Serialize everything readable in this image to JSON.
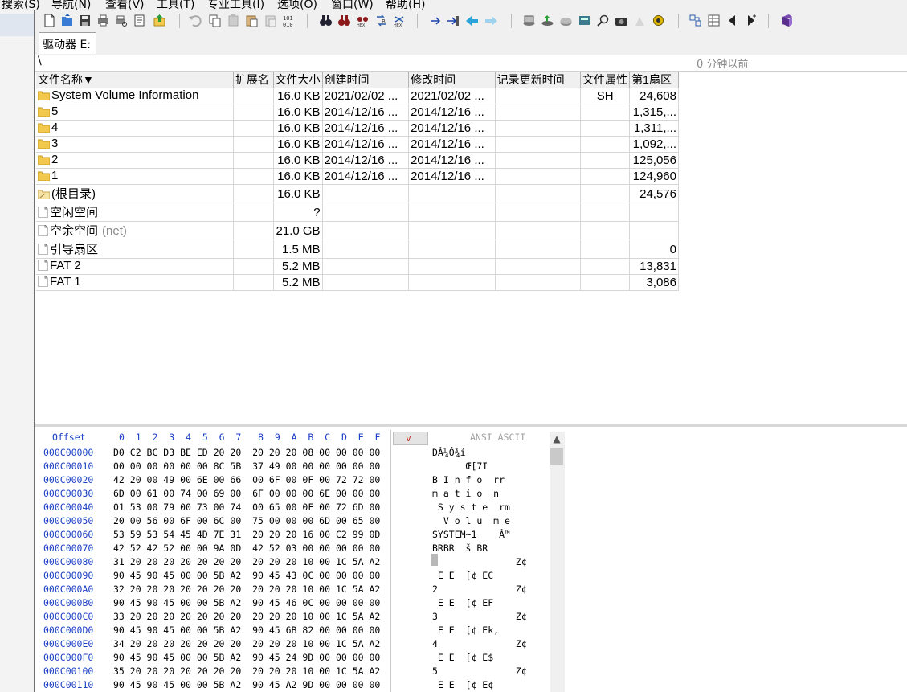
{
  "menu": [
    "搜索(S)",
    "导航(N)",
    "查看(V)",
    "工具(T)",
    "专业工具(I)",
    "选项(O)",
    "窗口(W)",
    "帮助(H)"
  ],
  "toolbar_icons": [
    "new-file-icon",
    "open-icon",
    "save-icon",
    "print-icon",
    "print-preview-icon",
    "properties-icon",
    "export-icon",
    "undo-icon",
    "copy-icon",
    "paste-icon",
    "paste-into-icon",
    "clipboard-icon",
    "convert-binary-icon",
    "find-icon",
    "find-text-icon",
    "find-hex-icon",
    "replace-text-icon",
    "replace-hex-icon",
    "goto-offset-icon",
    "goto-sector-icon",
    "back-arrow-icon",
    "forward-arrow-icon",
    "open-disk-icon",
    "disk-tools-icon",
    "disk-clone-icon",
    "calculator-icon",
    "search-icon",
    "camera-icon",
    "text-file-icon",
    "settings-gear-icon",
    "data-interpreter-icon",
    "template-icon",
    "prev-sector-icon",
    "next-sector-icon",
    "help-book-icon"
  ],
  "tab": {
    "label": "驱动器 E:"
  },
  "path": {
    "text": "\\",
    "time": "0 分钟以前"
  },
  "columns": [
    "文件名称▼",
    "扩展名",
    "文件大小",
    "创建时间",
    "修改时间",
    "记录更新时间",
    "文件属性",
    "第1扇区"
  ],
  "rows": [
    {
      "icon": "folder",
      "name": "System Volume Information",
      "ext": "",
      "size": "16.0 KB",
      "created": "2021/02/02  ...",
      "modified": "2021/02/02  ...",
      "updated": "",
      "attr": "SH",
      "sector": "24,608"
    },
    {
      "icon": "folder",
      "name": "5",
      "ext": "",
      "size": "16.0 KB",
      "created": "2014/12/16  ...",
      "modified": "2014/12/16  ...",
      "updated": "",
      "attr": "",
      "sector": "1,315,..."
    },
    {
      "icon": "folder",
      "name": "4",
      "ext": "",
      "size": "16.0 KB",
      "created": "2014/12/16  ...",
      "modified": "2014/12/16  ...",
      "updated": "",
      "attr": "",
      "sector": "1,311,..."
    },
    {
      "icon": "folder",
      "name": "3",
      "ext": "",
      "size": "16.0 KB",
      "created": "2014/12/16  ...",
      "modified": "2014/12/16  ...",
      "updated": "",
      "attr": "",
      "sector": "1,092,..."
    },
    {
      "icon": "folder",
      "name": "2",
      "ext": "",
      "size": "16.0 KB",
      "created": "2014/12/16  ...",
      "modified": "2014/12/16  ...",
      "updated": "",
      "attr": "",
      "sector": "125,056"
    },
    {
      "icon": "folder",
      "name": "1",
      "ext": "",
      "size": "16.0 KB",
      "created": "2014/12/16  ...",
      "modified": "2014/12/16  ...",
      "updated": "",
      "attr": "",
      "sector": "124,960"
    },
    {
      "icon": "root-folder",
      "name": "(根目录)",
      "ext": "",
      "size": "16.0 KB",
      "created": "",
      "modified": "",
      "updated": "",
      "attr": "",
      "sector": "24,576"
    },
    {
      "icon": "file",
      "name": "空闲空间",
      "ext": "",
      "size": "?",
      "created": "",
      "modified": "",
      "updated": "",
      "attr": "",
      "sector": ""
    },
    {
      "icon": "file",
      "name": "空余空间",
      "suffix": "(net)",
      "ext": "",
      "size": "21.0 GB",
      "created": "",
      "modified": "",
      "updated": "",
      "attr": "",
      "sector": ""
    },
    {
      "icon": "file",
      "name": "引导扇区",
      "ext": "",
      "size": "1.5 MB",
      "created": "",
      "modified": "",
      "updated": "",
      "attr": "",
      "sector": "0"
    },
    {
      "icon": "file",
      "name": "FAT 2",
      "ext": "",
      "size": "5.2 MB",
      "created": "",
      "modified": "",
      "updated": "",
      "attr": "",
      "sector": "13,831"
    },
    {
      "icon": "file",
      "name": "FAT 1",
      "ext": "",
      "size": "5.2 MB",
      "created": "",
      "modified": "",
      "updated": "",
      "attr": "",
      "sector": "3,086"
    }
  ],
  "hex": {
    "offset_label": "Offset",
    "col_headers": "0  1  2  3  4  5  6  7   8  9  A  B  C  D  E  F",
    "v_label": "v",
    "ascii_label": "ANSI ASCII",
    "lines": [
      {
        "offset": "000C00000",
        "bytes": "D0 C2 BC D3 BE ED 20 20  20 20 20 08 00 00 00 00",
        "ascii": "ĐÂ¼Ó¾í"
      },
      {
        "offset": "000C00010",
        "bytes": "00 00 00 00 00 00 8C 5B  37 49 00 00 00 00 00 00",
        "ascii": "      Œ[7I"
      },
      {
        "offset": "000C00020",
        "bytes": "42 20 00 49 00 6E 00 66  00 6F 00 0F 00 72 72 00",
        "ascii": "B I n f o  rr"
      },
      {
        "offset": "000C00030",
        "bytes": "6D 00 61 00 74 00 69 00  6F 00 00 00 6E 00 00 00",
        "ascii": "m a t i o  n"
      },
      {
        "offset": "000C00040",
        "bytes": "01 53 00 79 00 73 00 74  00 65 00 0F 00 72 6D 00",
        "ascii": " S y s t e  rm"
      },
      {
        "offset": "000C00050",
        "bytes": "20 00 56 00 6F 00 6C 00  75 00 00 00 6D 00 65 00",
        "ascii": "  V o l u  m e"
      },
      {
        "offset": "000C00060",
        "bytes": "53 59 53 54 45 4D 7E 31  20 20 20 16 00 C2 99 0D",
        "ascii": "SYSTEM~1    Â™"
      },
      {
        "offset": "000C00070",
        "bytes": "42 52 42 52 00 00 9A 0D  42 52 03 00 00 00 00 00",
        "ascii": "BRBR  š BR"
      },
      {
        "offset": "000C00080",
        "bytes": "31 20 20 20 20 20 20 20  20 20 20 10 00 1C 5A A2",
        "ascii": "1              Z¢"
      },
      {
        "offset": "000C00090",
        "bytes": "90 45 90 45 00 00 5B A2  90 45 43 0C 00 00 00 00",
        "ascii": " E E  [¢ EC"
      },
      {
        "offset": "000C000A0",
        "bytes": "32 20 20 20 20 20 20 20  20 20 20 10 00 1C 5A A2",
        "ascii": "2              Z¢"
      },
      {
        "offset": "000C000B0",
        "bytes": "90 45 90 45 00 00 5B A2  90 45 46 0C 00 00 00 00",
        "ascii": " E E  [¢ EF"
      },
      {
        "offset": "000C000C0",
        "bytes": "33 20 20 20 20 20 20 20  20 20 20 10 00 1C 5A A2",
        "ascii": "3              Z¢"
      },
      {
        "offset": "000C000D0",
        "bytes": "90 45 90 45 00 00 5B A2  90 45 6B 82 00 00 00 00",
        "ascii": " E E  [¢ Ek‚"
      },
      {
        "offset": "000C000E0",
        "bytes": "34 20 20 20 20 20 20 20  20 20 20 10 00 1C 5A A2",
        "ascii": "4              Z¢"
      },
      {
        "offset": "000C000F0",
        "bytes": "90 45 90 45 00 00 5B A2  90 45 24 9D 00 00 00 00",
        "ascii": " E E  [¢ E$"
      },
      {
        "offset": "000C00100",
        "bytes": "35 20 20 20 20 20 20 20  20 20 20 10 00 1C 5A A2",
        "ascii": "5              Z¢"
      },
      {
        "offset": "000C00110",
        "bytes": "90 45 90 45 00 00 5B A2  90 45 A2 9D 00 00 00 00",
        "ascii": " E E  [¢ E¢"
      }
    ]
  },
  "colors": {
    "hex_blue": "#1c3fc4",
    "folder_yellow": "#f2c94c",
    "gray_text": "#8a8a8a"
  }
}
